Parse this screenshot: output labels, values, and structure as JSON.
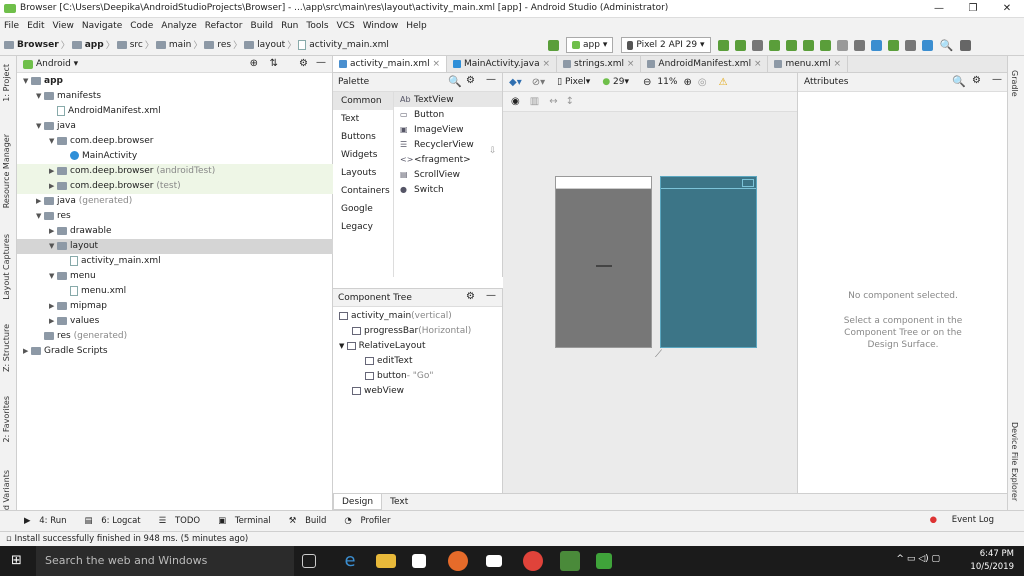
{
  "window": {
    "title": "Browser [C:\\Users\\Deepika\\AndroidStudioProjects\\Browser] - ...\\app\\src\\main\\res\\layout\\activity_main.xml [app] - Android Studio (Administrator)",
    "minimize": "—",
    "maximize": "❐",
    "close": "✕"
  },
  "menu": [
    "File",
    "Edit",
    "View",
    "Navigate",
    "Code",
    "Analyze",
    "Refactor",
    "Build",
    "Run",
    "Tools",
    "VCS",
    "Window",
    "Help"
  ],
  "breadcrumb": [
    "Browser",
    "app",
    "src",
    "main",
    "res",
    "layout",
    "activity_main.xml"
  ],
  "run_config": "app",
  "device": "Pixel 2 API 29",
  "left_tool_tabs": [
    "1: Project",
    "Resource Manager",
    "Layout Captures",
    "Z: Structure",
    "2: Favorites",
    "ld Variants"
  ],
  "project_panel": {
    "view_mode": "Android",
    "tree": [
      {
        "label": "app",
        "indent": 0,
        "arrow": "▼",
        "icon": "folder",
        "bold": true
      },
      {
        "label": "manifests",
        "indent": 1,
        "arrow": "▼",
        "icon": "folder"
      },
      {
        "label": "AndroidManifest.xml",
        "indent": 2,
        "arrow": "",
        "icon": "doc"
      },
      {
        "label": "java",
        "indent": 1,
        "arrow": "▼",
        "icon": "folder"
      },
      {
        "label": "com.deep.browser",
        "indent": 2,
        "arrow": "▼",
        "icon": "folder"
      },
      {
        "label": "MainActivity",
        "indent": 3,
        "arrow": "",
        "icon": "java"
      },
      {
        "label": "com.deep.browser",
        "suffix": " (androidTest)",
        "indent": 2,
        "arrow": "▶",
        "icon": "folder",
        "green": true
      },
      {
        "label": "com.deep.browser",
        "suffix": " (test)",
        "indent": 2,
        "arrow": "▶",
        "icon": "folder",
        "green": true
      },
      {
        "label": "java",
        "suffix": " (generated)",
        "indent": 1,
        "arrow": "▶",
        "icon": "folder"
      },
      {
        "label": "res",
        "indent": 1,
        "arrow": "▼",
        "icon": "folder"
      },
      {
        "label": "drawable",
        "indent": 2,
        "arrow": "▶",
        "icon": "folder"
      },
      {
        "label": "layout",
        "indent": 2,
        "arrow": "▼",
        "icon": "folder",
        "selected": true
      },
      {
        "label": "activity_main.xml",
        "indent": 3,
        "arrow": "",
        "icon": "doc"
      },
      {
        "label": "menu",
        "indent": 2,
        "arrow": "▼",
        "icon": "folder"
      },
      {
        "label": "menu.xml",
        "indent": 3,
        "arrow": "",
        "icon": "doc"
      },
      {
        "label": "mipmap",
        "indent": 2,
        "arrow": "▶",
        "icon": "folder"
      },
      {
        "label": "values",
        "indent": 2,
        "arrow": "▶",
        "icon": "folder"
      },
      {
        "label": "res",
        "suffix": " (generated)",
        "indent": 1,
        "arrow": "",
        "icon": "folder"
      },
      {
        "label": "Gradle Scripts",
        "indent": 0,
        "arrow": "▶",
        "icon": "folder"
      }
    ]
  },
  "editor_tabs": [
    {
      "label": "activity_main.xml",
      "active": true,
      "color": "#4a8fcf"
    },
    {
      "label": "MainActivity.java",
      "active": false,
      "color": "#2f8fd8"
    },
    {
      "label": "strings.xml",
      "active": false,
      "color": "#8d99a6"
    },
    {
      "label": "AndroidManifest.xml",
      "active": false,
      "color": "#8d99a6"
    },
    {
      "label": "menu.xml",
      "active": false,
      "color": "#8d99a6"
    }
  ],
  "palette": {
    "title": "Palette",
    "categories": [
      "Common",
      "Text",
      "Buttons",
      "Widgets",
      "Layouts",
      "Containers",
      "Google",
      "Legacy"
    ],
    "items": [
      {
        "glyph": "Ab",
        "label": "TextView"
      },
      {
        "glyph": "▭",
        "label": "Button"
      },
      {
        "glyph": "▣",
        "label": "ImageView"
      },
      {
        "glyph": "☰",
        "label": "RecyclerView"
      },
      {
        "glyph": "<>",
        "label": "<fragment>"
      },
      {
        "glyph": "▤",
        "label": "ScrollView"
      },
      {
        "glyph": "●",
        "label": "Switch"
      }
    ]
  },
  "component_tree": {
    "title": "Component Tree",
    "rows": [
      {
        "label": "activity_main",
        "suffix": "(vertical)",
        "indent": 0
      },
      {
        "label": "progressBar",
        "suffix": "(Horizontal)",
        "indent": 1
      },
      {
        "label": "RelativeLayout",
        "suffix": "",
        "indent": 0,
        "arrow": "▼"
      },
      {
        "label": "editText",
        "suffix": "",
        "indent": 2
      },
      {
        "label": "button",
        "suffix": "- \"Go\"",
        "indent": 2
      },
      {
        "label": "webView",
        "suffix": "",
        "indent": 1
      }
    ]
  },
  "design_toolbar": {
    "device": "Pixel",
    "api": "29",
    "zoom": "11%"
  },
  "attributes": {
    "title": "Attributes",
    "empty_title": "No component selected.",
    "empty_hint": "Select a component in the Component Tree or on the Design Surface."
  },
  "bottom_tabs": [
    "Design",
    "Text"
  ],
  "right_tool_tabs": [
    "Gradle",
    "Device File Explorer"
  ],
  "tool_windows": [
    "4: Run",
    "6: Logcat",
    "TODO",
    "Terminal",
    "Build",
    "Profiler"
  ],
  "event_log": "Event Log",
  "status": "Install successfully finished in 948 ms. (5 minutes ago)",
  "taskbar": {
    "search_placeholder": "Search the web and Windows",
    "time": "6:47 PM",
    "date": "10/5/2019"
  }
}
